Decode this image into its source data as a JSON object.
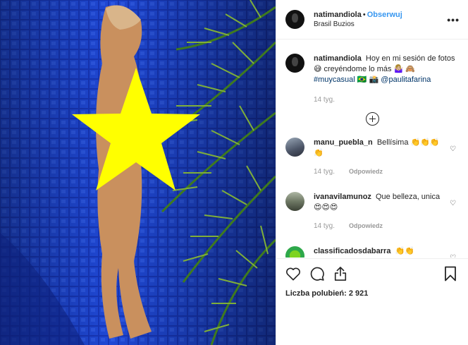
{
  "header": {
    "username": "natimandiola",
    "separator": "•",
    "follow_label": "Obserwuj",
    "location": "Brasil Buzios",
    "more_label": "•••"
  },
  "caption": {
    "username": "natimandiola",
    "text": "Hoy en mi sesión de fotos😅 creyéndome lo más 🤷🏼‍♀️ 🙈",
    "hashtag": "#muycasual",
    "flag": "🇧🇷",
    "emoji2": "📸",
    "mention": "@paulitafarina",
    "time": "14 tyg."
  },
  "load_more_icon": "plus-circle-icon",
  "comments": [
    {
      "username": "manu_puebla_n",
      "text": "Bellísima 👏👏👏 👏",
      "time": "14 tyg.",
      "reply": "Odpowiedz"
    },
    {
      "username": "ivanavilamunoz",
      "text": "Que belleza, unica😍😍😍",
      "time": "14 tyg.",
      "reply": "Odpowiedz"
    },
    {
      "username": "classificadosdabarra",
      "text": "👏👏",
      "time": "",
      "reply": ""
    }
  ],
  "actions": {
    "icons": [
      "heart-icon",
      "comment-icon",
      "share-icon",
      "bookmark-icon"
    ],
    "likes_label": "Liczba polubień:",
    "likes_count": "2 921"
  },
  "colors": {
    "follow": "#3897f0",
    "hashtag": "#003569",
    "censor_star": "#ffff00",
    "pool_tiles": "#1530a8"
  }
}
